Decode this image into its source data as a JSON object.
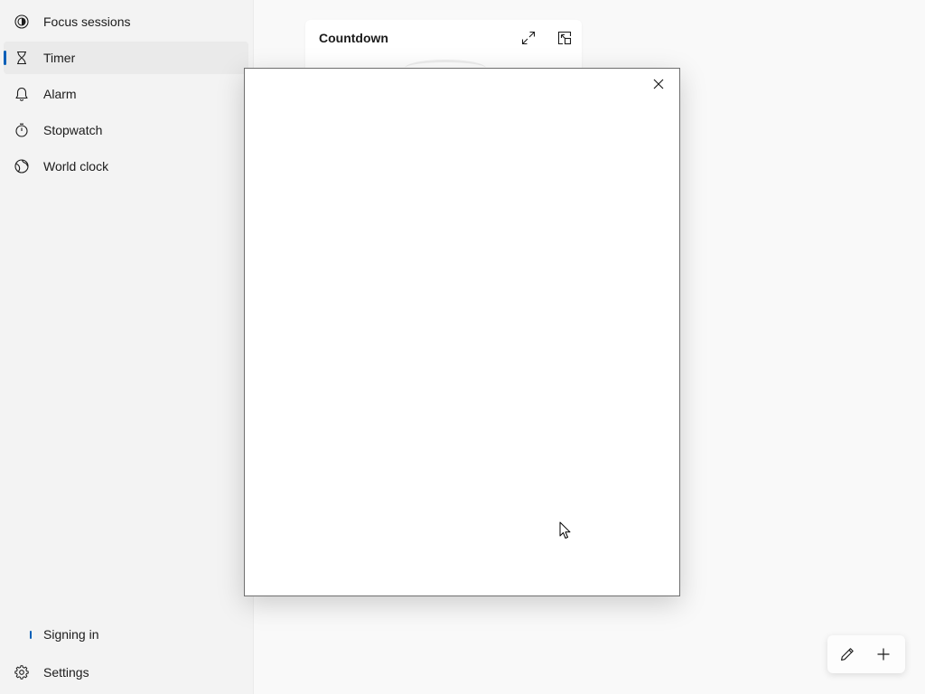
{
  "sidebar": {
    "items": [
      {
        "label": "Focus sessions",
        "icon": "focus-icon",
        "selected": false
      },
      {
        "label": "Timer",
        "icon": "hourglass-icon",
        "selected": true
      },
      {
        "label": "Alarm",
        "icon": "bell-icon",
        "selected": false
      },
      {
        "label": "Stopwatch",
        "icon": "stopwatch-icon",
        "selected": false
      },
      {
        "label": "World clock",
        "icon": "globe-icon",
        "selected": false
      }
    ],
    "signin_label": "Signing in",
    "settings_label": "Settings"
  },
  "main": {
    "card": {
      "title": "Countdown",
      "expand_icon": "expand-icon",
      "pip_icon": "picture-in-picture-icon"
    },
    "fab": {
      "edit_icon": "pencil-icon",
      "add_icon": "plus-icon"
    }
  },
  "popup": {
    "close_icon": "close-icon"
  },
  "colors": {
    "accent": "#005fb8",
    "sidebar_bg": "#f3f3f3",
    "main_bg": "#f9f9f9",
    "selected_bg": "#eaeaea"
  }
}
